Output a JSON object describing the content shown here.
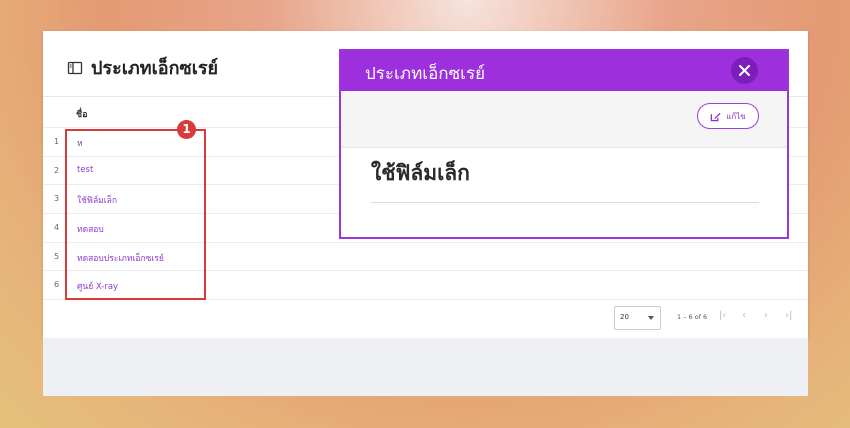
{
  "page": {
    "title": "ประเภทเอ็กซเรย์",
    "title_icon": "sidebar-panel-icon"
  },
  "table": {
    "column_name": "ชื่อ",
    "rows": [
      {
        "index": "1",
        "name": "ห"
      },
      {
        "index": "2",
        "name": "test"
      },
      {
        "index": "3",
        "name": "ใช้ฟิล์มเล็ก"
      },
      {
        "index": "4",
        "name": "ทดสอบ"
      },
      {
        "index": "5",
        "name": "ทดสอบประเภทเอ็กซเรย์"
      },
      {
        "index": "6",
        "name": "ศูนย์ X-ray"
      }
    ]
  },
  "pagination": {
    "page_size": "20",
    "range": "1 – 6 of 6"
  },
  "annotation": {
    "badge": "1",
    "color": "#d93a3a"
  },
  "dialog": {
    "title": "ประเภทเอ็กซเรย์",
    "edit_label": "แก้ไข",
    "record_name": "ใช้ฟิล์มเล็ก",
    "accent": "#9d30dc"
  }
}
